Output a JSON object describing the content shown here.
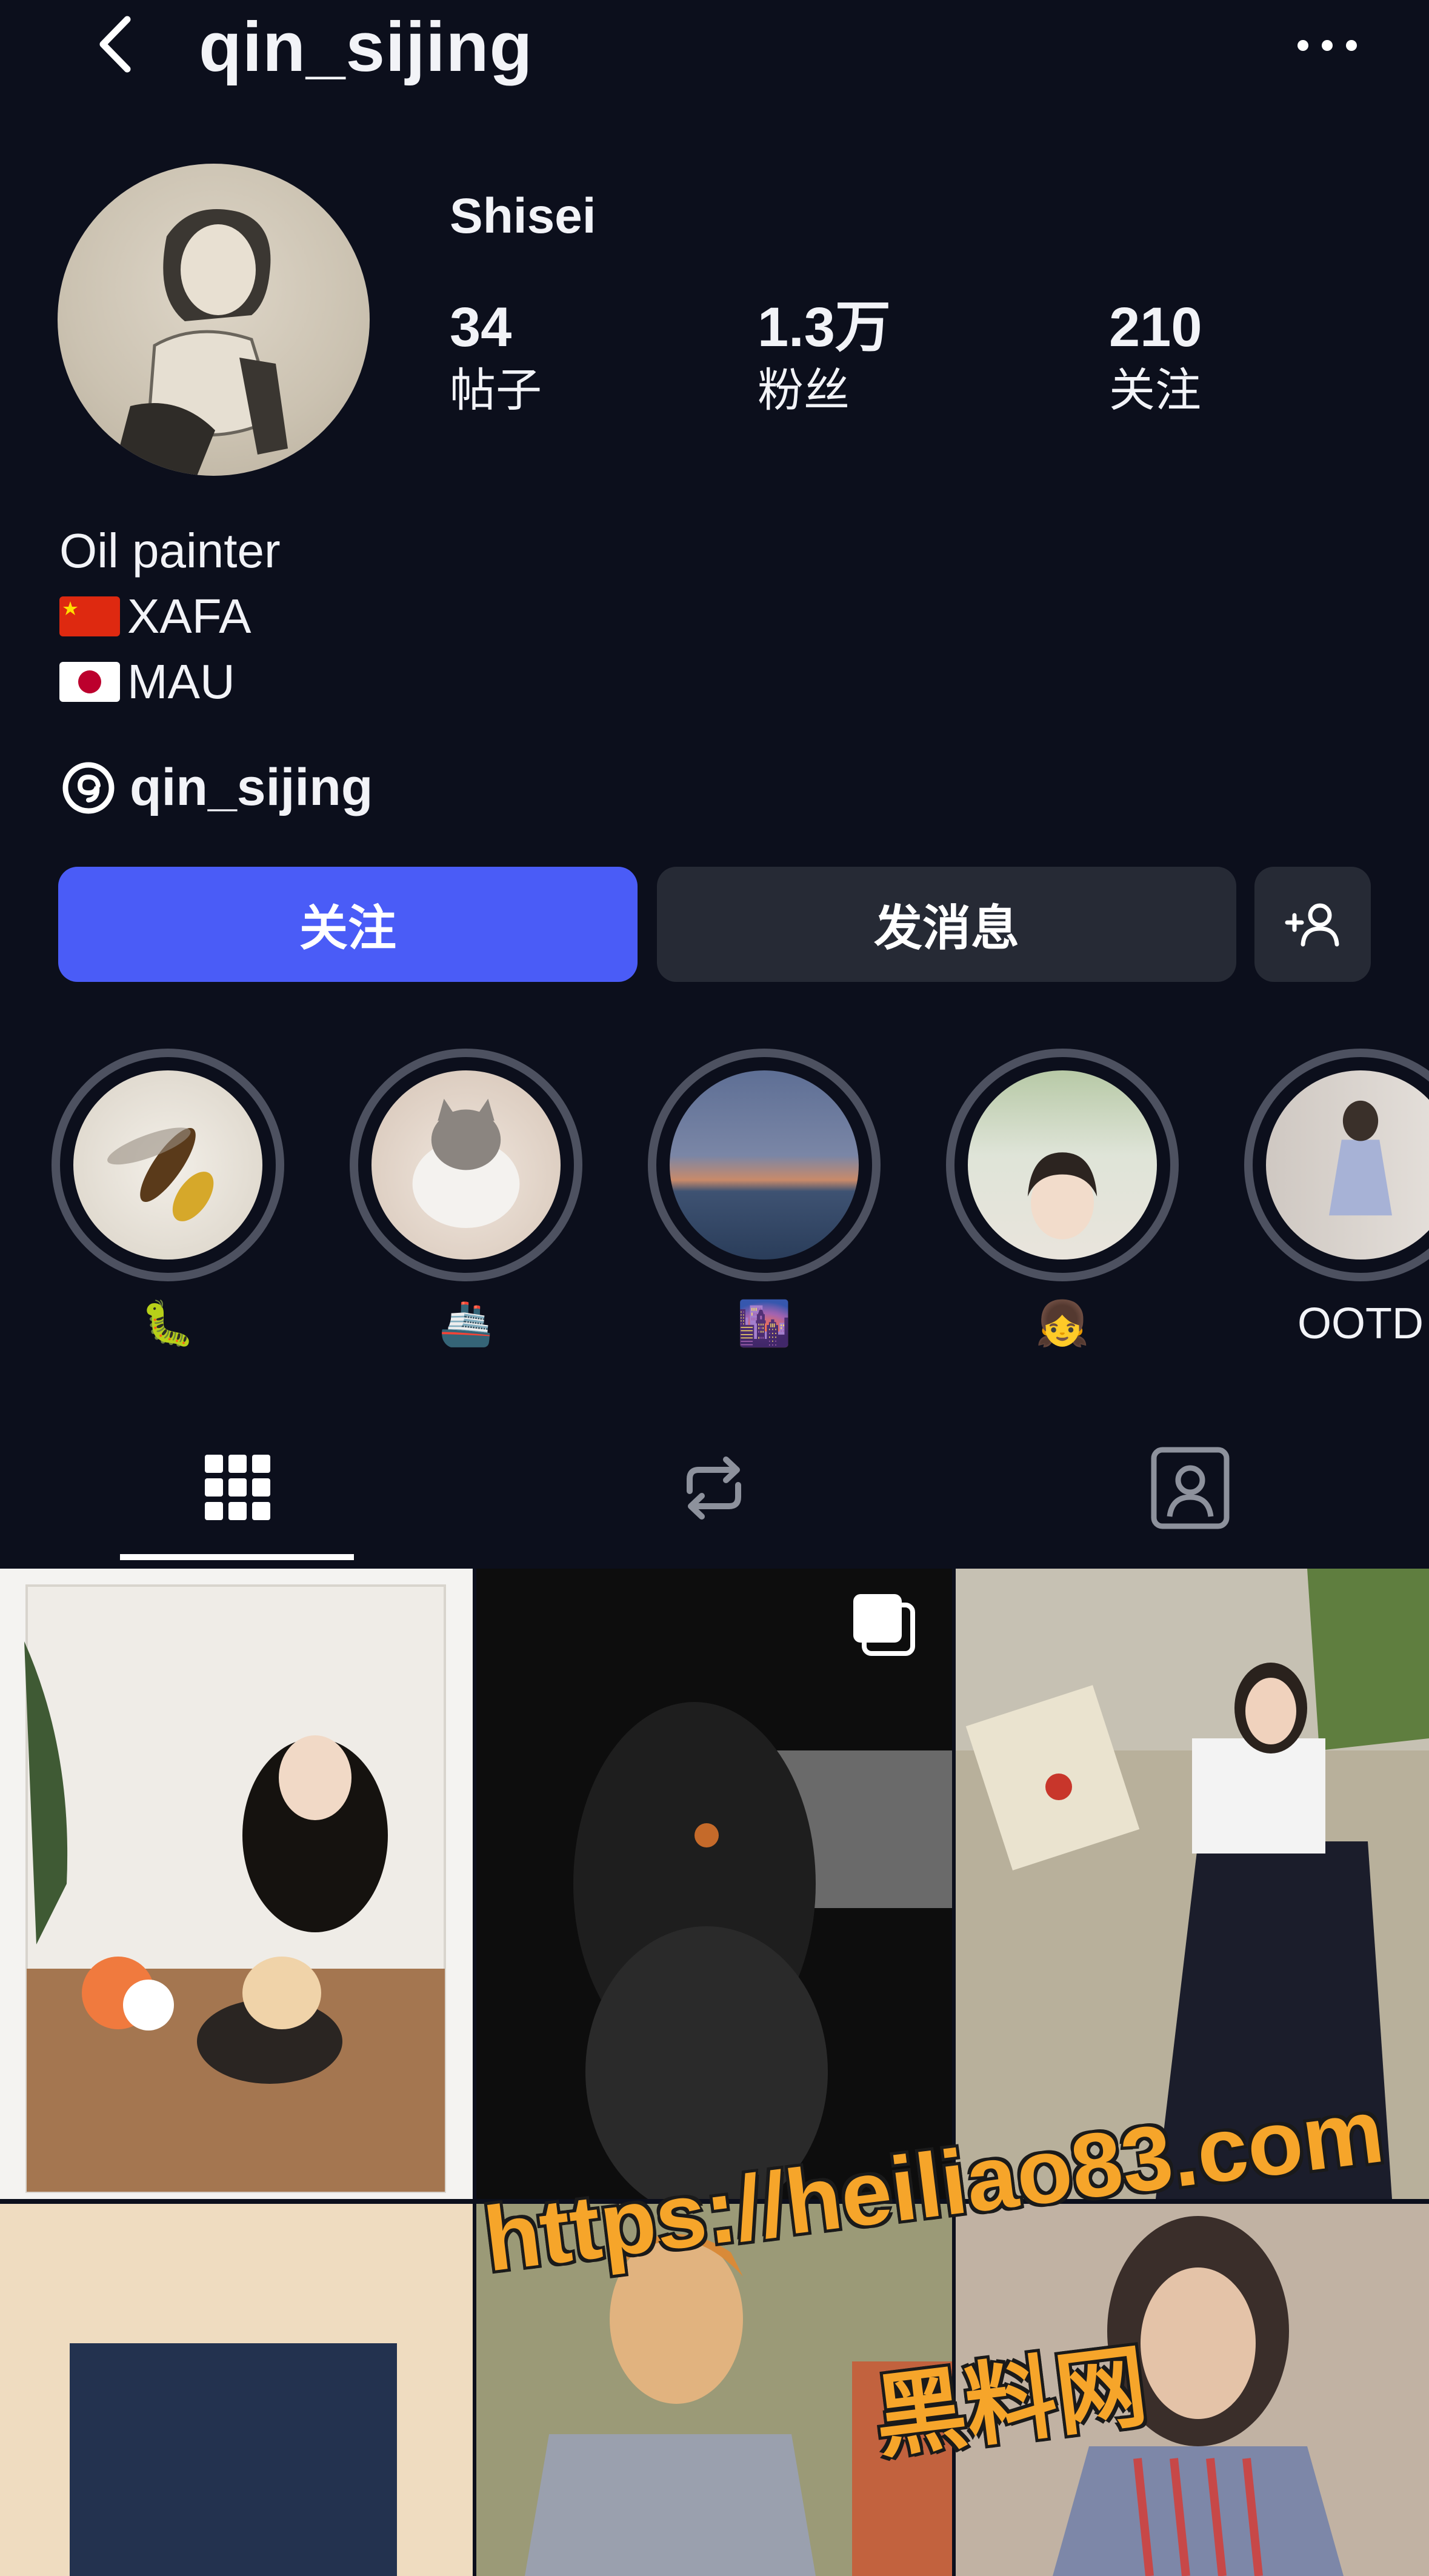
{
  "header": {
    "username": "qin_sijing",
    "back_icon": "chevron-left-icon",
    "more_icon": "more-horizontal-icon"
  },
  "profile": {
    "display_name": "Shisei",
    "stats": [
      {
        "value": "34",
        "label": "帖子"
      },
      {
        "value": "1.3万",
        "label": "粉丝"
      },
      {
        "value": "210",
        "label": "关注"
      }
    ],
    "bio": [
      {
        "flag": "cn-flag-icon",
        "text": "Oil painter"
      },
      {
        "flag": "cn-flag-icon",
        "text": "XAFA"
      },
      {
        "flag": "jp-flag-icon",
        "text": "MAU"
      }
    ],
    "threads_handle": "qin_sijing"
  },
  "actions": {
    "follow_label": "关注",
    "message_label": "发消息",
    "add_user_icon": "add-user-icon"
  },
  "highlights": [
    {
      "label": "🐛",
      "image": "wasp"
    },
    {
      "label": "🚢",
      "image": "cat"
    },
    {
      "label": "🌆",
      "image": "sea-sunset"
    },
    {
      "label": "👧",
      "image": "girl-selfie"
    },
    {
      "label": "OOTD",
      "image": "outfit"
    }
  ],
  "tabs": [
    "grid-icon",
    "reels-repost-icon",
    "tagged-icon"
  ],
  "watermark": {
    "url": "https://heiliao83.com",
    "text": "黑料网"
  },
  "colors": {
    "background": "#0c0f1c",
    "accent": "#4a5cf7",
    "button_secondary": "#262a35"
  }
}
